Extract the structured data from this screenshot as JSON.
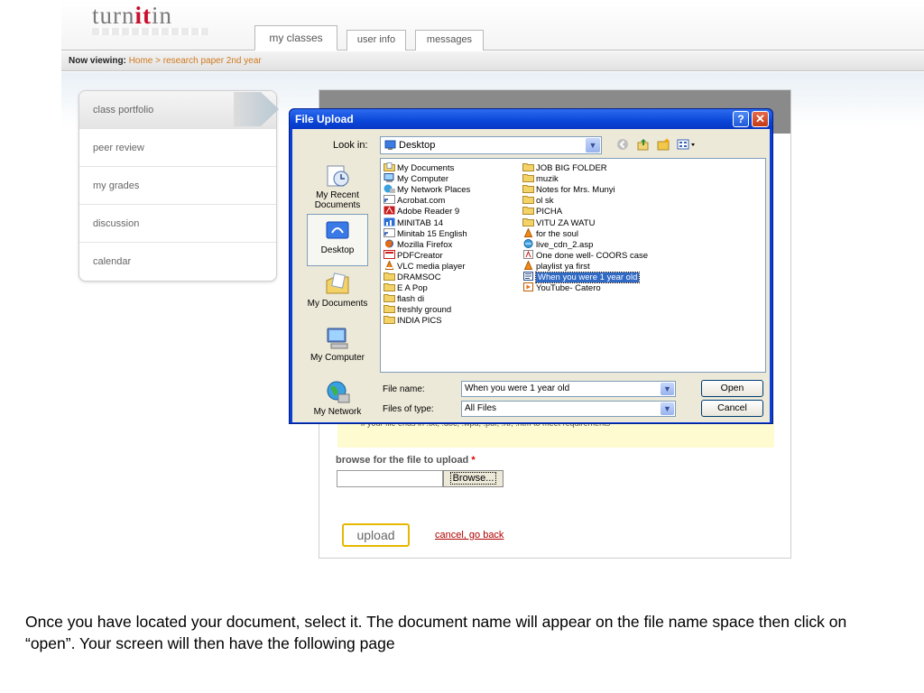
{
  "app": {
    "logo": {
      "prefix": "turn",
      "accent": "it",
      "suffix": "in"
    },
    "tabs": [
      {
        "label": "my classes",
        "active": true
      },
      {
        "label": "user info",
        "active": false
      },
      {
        "label": "messages",
        "active": false
      }
    ],
    "now_viewing": {
      "label": "Now viewing:",
      "path": "Home > research paper 2nd year"
    },
    "sidebar": [
      {
        "label": "class portfolio",
        "active": true
      },
      {
        "label": "peer review"
      },
      {
        "label": "my grades"
      },
      {
        "label": "discussion"
      },
      {
        "label": "calendar"
      }
    ],
    "main": {
      "note_text": "if your file ends in .txt, .doc, .wpd, .pdf, .rtf, .htm to meet requirements",
      "browse_label": "browse for the file to upload",
      "required_mark": "*",
      "browse_button": "Browse...",
      "upload_button": "upload",
      "cancel_link": "cancel, go back"
    }
  },
  "dialog": {
    "title": "File Upload",
    "help_label": "?",
    "close_label": "✕",
    "look_in_label": "Look in:",
    "look_in_value": "Desktop",
    "places": [
      "My Recent Documents",
      "Desktop",
      "My Documents",
      "My Computer",
      "My Network"
    ],
    "files_col1": [
      {
        "name": "My Documents",
        "icon": "my-documents-icon"
      },
      {
        "name": "My Computer",
        "icon": "my-computer-icon"
      },
      {
        "name": "My Network Places",
        "icon": "network-places-icon"
      },
      {
        "name": "Acrobat.com",
        "icon": "shortcut-icon"
      },
      {
        "name": "Adobe Reader 9",
        "icon": "adobe-reader-icon"
      },
      {
        "name": "MINITAB 14",
        "icon": "minitab-icon"
      },
      {
        "name": "Minitab 15 English",
        "icon": "shortcut-icon"
      },
      {
        "name": "Mozilla Firefox",
        "icon": "firefox-icon"
      },
      {
        "name": "PDFCreator",
        "icon": "pdfcreator-icon"
      },
      {
        "name": "VLC media player",
        "icon": "vlc-icon"
      },
      {
        "name": "DRAMSOC",
        "icon": "folder-icon"
      },
      {
        "name": "E A Pop",
        "icon": "folder-icon"
      },
      {
        "name": "flash di",
        "icon": "folder-icon"
      },
      {
        "name": "freshly ground",
        "icon": "folder-icon"
      },
      {
        "name": "INDIA PICS",
        "icon": "folder-icon"
      }
    ],
    "files_col2": [
      {
        "name": "JOB BIG FOLDER",
        "icon": "folder-icon"
      },
      {
        "name": "muzik",
        "icon": "folder-icon"
      },
      {
        "name": "Notes for Mrs. Munyi",
        "icon": "folder-icon"
      },
      {
        "name": "ol sk",
        "icon": "folder-icon"
      },
      {
        "name": "PICHA",
        "icon": "folder-icon"
      },
      {
        "name": "VITU ZA WATU",
        "icon": "folder-icon"
      },
      {
        "name": "for the soul",
        "icon": "vlc-file-icon"
      },
      {
        "name": "live_cdn_2.asp",
        "icon": "asp-file-icon"
      },
      {
        "name": "One done well- COORS case",
        "icon": "pdf-file-icon"
      },
      {
        "name": "playlist ya first",
        "icon": "vlc-file-icon"
      },
      {
        "name": "When you were 1 year old",
        "icon": "word-document-icon",
        "selected": true
      },
      {
        "name": "YouTube- Catero",
        "icon": "video-file-icon"
      }
    ],
    "file_name_label": "File name:",
    "file_name_value": "When you were 1 year old",
    "file_type_label": "Files of type:",
    "file_type_value": "All Files",
    "open_button": "Open",
    "cancel_button": "Cancel"
  },
  "caption": "Once you have located your document, select it. The document name will appear on the file name space then click on “open”. Your screen will then have the following page",
  "colors": {
    "dialog_title": "#0a46d8",
    "selection": "#316ac5",
    "brand_accent": "#c8102e",
    "breadcrumb": "#d07a1e",
    "cancel_link": "#b00000",
    "upload_border": "#e6b800"
  }
}
